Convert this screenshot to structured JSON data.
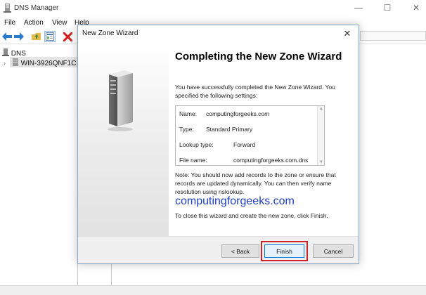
{
  "app": {
    "title": "DNS Manager",
    "menu": [
      "File",
      "Action",
      "View",
      "Help"
    ],
    "toolbar_icons": [
      "back-arrow-icon",
      "forward-arrow-icon",
      "folder-up-icon",
      "properties-icon",
      "delete-icon"
    ]
  },
  "tree": {
    "root_label": "DNS",
    "server_label": "WIN-3926QNF1C"
  },
  "wizard": {
    "window_title": "New Zone Wizard",
    "heading": "Completing the New Zone Wizard",
    "intro": "You have successfully completed the New Zone Wizard. You specified the following settings:",
    "settings": [
      {
        "label": "Name:",
        "value": "computingforgeeks.com"
      },
      {
        "label": "Type:",
        "value": "Standard Primary"
      },
      {
        "label": "Lookup type:",
        "value": "Forward"
      },
      {
        "label": "File name:",
        "value": "computingforgeeks.com.dns"
      }
    ],
    "note": "Note: You should now add records to the zone or ensure that records are updated dynamically. You can then verify name resolution using nslookup.",
    "watermark": "computingforgeeks.com",
    "closing": "To close this wizard and create the new zone, click Finish.",
    "buttons": {
      "back": "< Back",
      "finish": "Finish",
      "cancel": "Cancel"
    }
  },
  "colors": {
    "highlight": "#d2232a",
    "watermark": "#1f3fbf",
    "delete_icon": "#d42020"
  }
}
